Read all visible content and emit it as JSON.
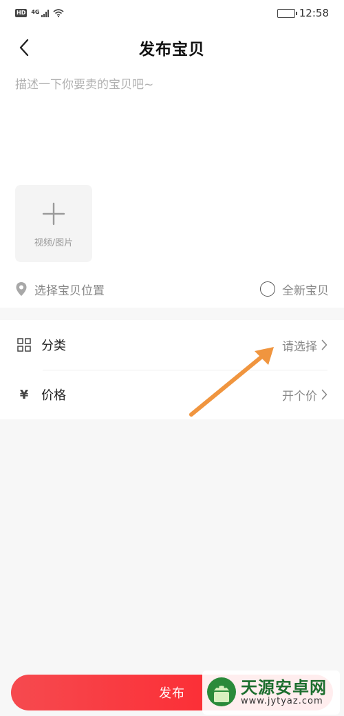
{
  "status_bar": {
    "hd": "HD",
    "network": "4G",
    "time": "12:58",
    "battery_level": 0.75
  },
  "header": {
    "title": "发布宝贝",
    "back_icon": "chevron-left-icon"
  },
  "description": {
    "placeholder": "描述一下你要卖的宝贝吧~",
    "value": ""
  },
  "media": {
    "label": "视频/图片",
    "icon": "plus-icon"
  },
  "location": {
    "label": "选择宝贝位置",
    "icon": "location-pin-icon"
  },
  "brand_new": {
    "label": "全新宝贝",
    "checked": false
  },
  "list": {
    "category": {
      "label": "分类",
      "value": "请选择",
      "icon": "grid-icon"
    },
    "price": {
      "label": "价格",
      "value": "开个价",
      "icon_glyph": "¥"
    }
  },
  "publish": {
    "label": "发布"
  },
  "colors": {
    "accent": "#ff2a2f",
    "annotation_arrow": "#f0953f"
  },
  "watermark": {
    "title": "天源安卓网",
    "url": "www.jytyaz.com"
  }
}
